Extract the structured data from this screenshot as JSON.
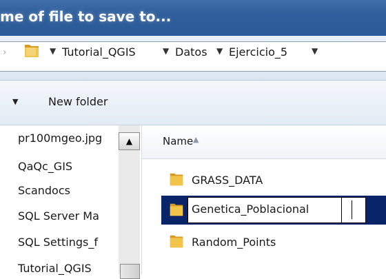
{
  "window": {
    "title": "me of file to save to..."
  },
  "address_bar": {
    "crumbs": [
      "Tutorial_QGIS",
      "Datos",
      "Ejercicio_5"
    ]
  },
  "toolbar": {
    "new_folder_label": "New folder"
  },
  "nav_pane": {
    "items": [
      "pr100mgeo.jpg",
      "QaQc_GIS",
      "Scandocs",
      "SQL Server Ma",
      "SQL Settings_f",
      "Tutorial_QGIS"
    ]
  },
  "file_list": {
    "column_header": "Name",
    "rows": [
      {
        "name": "GRASS_DATA",
        "selected": false
      },
      {
        "name": "Genetica_Poblacional",
        "selected": true,
        "editing": true
      },
      {
        "name": "Random_Points",
        "selected": false
      }
    ]
  },
  "colors": {
    "title_bar": "#2f5f9c",
    "selection": "#0a246a",
    "folder": "#e8b23a"
  },
  "icons": {
    "folder": "folder-icon",
    "dropdown": "chevron-down-icon",
    "sort": "sort-ascending-icon"
  }
}
